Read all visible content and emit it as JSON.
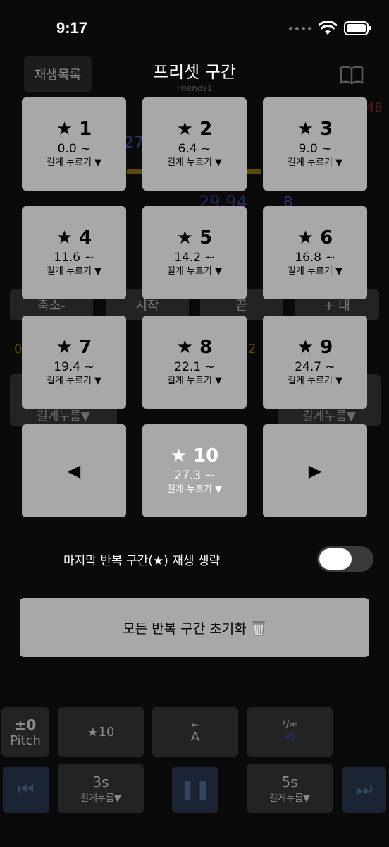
{
  "status": {
    "time": "9:17"
  },
  "background": {
    "playlist_label": "재생목록",
    "song_subtitle": "Friends1",
    "num_left": "27",
    "num_center": "29.94",
    "num_right": "48",
    "zoom_out": "축소-",
    "start": "시작",
    "end": "끝",
    "zoom_in": "+ 대",
    "hold_left": "길게누름▼",
    "hold_right": "길게누름▼",
    "small_left": "0",
    "small_mid": "2",
    "b": "B",
    "toolbar": {
      "pitch_value": "±0",
      "pitch_label": "Pitch",
      "star10": "★10",
      "a_label": "A",
      "loop_label": "³/∞",
      "rewind_label": "3s",
      "rewind_hint": "길게누름▼",
      "forward_label": "5s",
      "forward_hint": "길게누름▼"
    }
  },
  "overlay": {
    "title": "프리셋 구간",
    "presets": [
      {
        "name": "★ 1",
        "time": "0.0 ~",
        "hint": "길게 누르기 ▼"
      },
      {
        "name": "★ 2",
        "time": "6.4 ~",
        "hint": "길게 누르기 ▼"
      },
      {
        "name": "★ 3",
        "time": "9.0 ~",
        "hint": "길게 누르기 ▼"
      },
      {
        "name": "★ 4",
        "time": "11.6 ~",
        "hint": "길게 누르기 ▼"
      },
      {
        "name": "★ 5",
        "time": "14.2 ~",
        "hint": "길게 누르기 ▼"
      },
      {
        "name": "★ 6",
        "time": "16.8 ~",
        "hint": "길게 누르기 ▼"
      },
      {
        "name": "★ 7",
        "time": "19.4 ~",
        "hint": "길게 누르기 ▼"
      },
      {
        "name": "★ 8",
        "time": "22.1 ~",
        "hint": "길게 누르기 ▼"
      },
      {
        "name": "★ 9",
        "time": "24.7 ~",
        "hint": "길게 누르기 ▼"
      },
      {
        "name": "★ 10",
        "time": "27.3 ~",
        "hint": "길게 누르기 ▼"
      }
    ],
    "prev_glyph": "◀",
    "next_glyph": "▶",
    "skip_last_label": "마지막 반복 구간(★) 재생 생략",
    "skip_last_enabled": false,
    "reset_label": "모든 반복 구간 초기화",
    "colors": {
      "tile": "#a8a8a8",
      "background": "#0a0a0a",
      "toggle_off": "#3a3a3c"
    }
  }
}
